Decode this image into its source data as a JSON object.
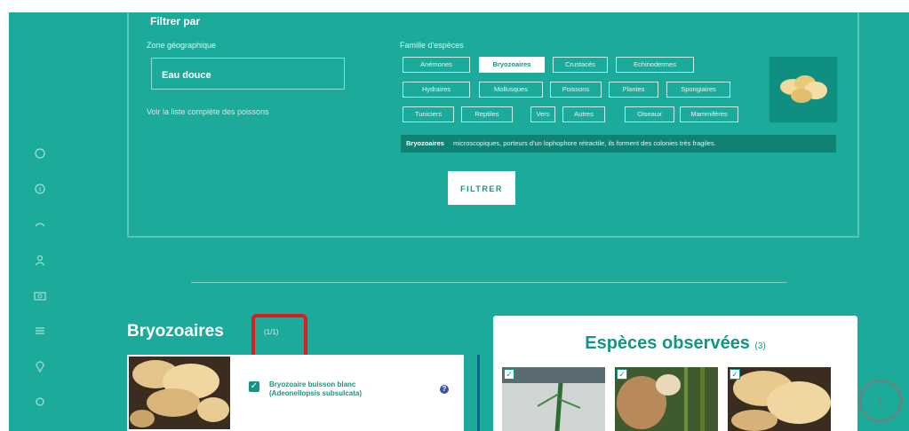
{
  "filter": {
    "title": "Filtrer par",
    "zone_label": "Zone géographique",
    "zone_value": "Eau douce",
    "family_label": "Famille d'espèces",
    "view_all_link": "Voir la liste complète des poissons",
    "chips": [
      "Anémones",
      "Bryozoaires",
      "Crustacés",
      "Echinodermes",
      "Hydraires",
      "Mollusques",
      "Poissons",
      "Plantes",
      "Spongiaires",
      "Tuniciers",
      "Reptiles",
      "Vers",
      "Autres",
      "Oiseaux",
      "Mammifères"
    ],
    "selected_chip": "Bryozoaires",
    "description_term": "Bryozoaires",
    "description_text": "microscopiques, porteurs d'un lophophore rétractile, ils forment des colonies très fragiles.",
    "button_label": "FILTRER"
  },
  "results": {
    "title": "Bryozoaires",
    "count": "(1/1)",
    "cards": [
      {
        "name": "Bryozoaire buisson blanc (Adeonellopsis subsulcata)",
        "checked": true
      }
    ]
  },
  "observed": {
    "title": "Espèces observées",
    "count": "(3)"
  },
  "sidebar": {
    "icons": [
      "home-icon",
      "info-icon",
      "search-icon",
      "user-icon",
      "camera-icon",
      "list-icon",
      "location-icon",
      "settings-icon"
    ]
  },
  "colors": {
    "background": "#1cab9a",
    "accent": "#139585",
    "highlight": "#e01b1b"
  }
}
